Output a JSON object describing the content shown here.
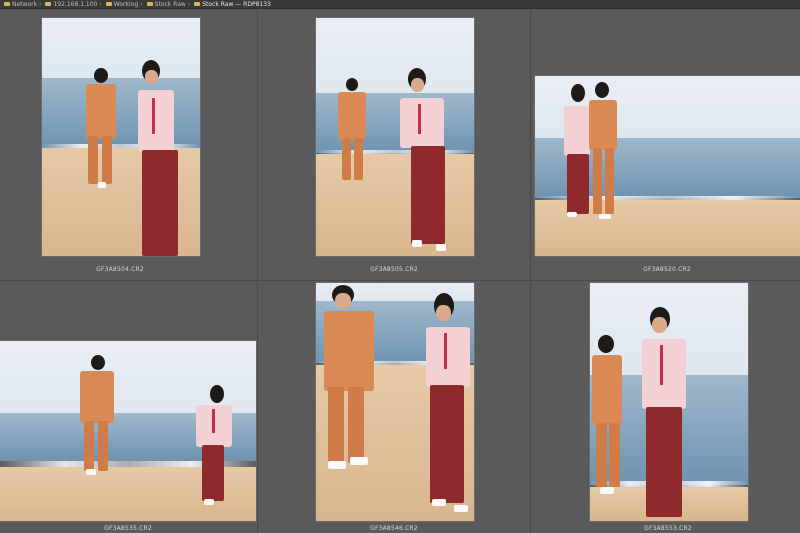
{
  "breadcrumbs": [
    {
      "label": "Network"
    },
    {
      "label": "192.168.1.100"
    },
    {
      "label": "Working"
    },
    {
      "label": "Stock Raw"
    },
    {
      "label": "Stock Raw — RDP8133"
    }
  ],
  "thumbnails": [
    {
      "file": "GF3A8504.CR2"
    },
    {
      "file": "GF3A8505.CR2"
    },
    {
      "file": "GF3A8520.CR2"
    },
    {
      "file": "GF3A8535.CR2"
    },
    {
      "file": "GF3A8546.CR2"
    },
    {
      "file": "GF3A8553.CR2"
    }
  ],
  "colors": {
    "background": "#5a5a5a",
    "suit": "#d98a54",
    "pants": "#8e2a2c",
    "blouse": "#f2d0d4",
    "sea": "#6e93b0",
    "sand": "#e6c9a6"
  }
}
